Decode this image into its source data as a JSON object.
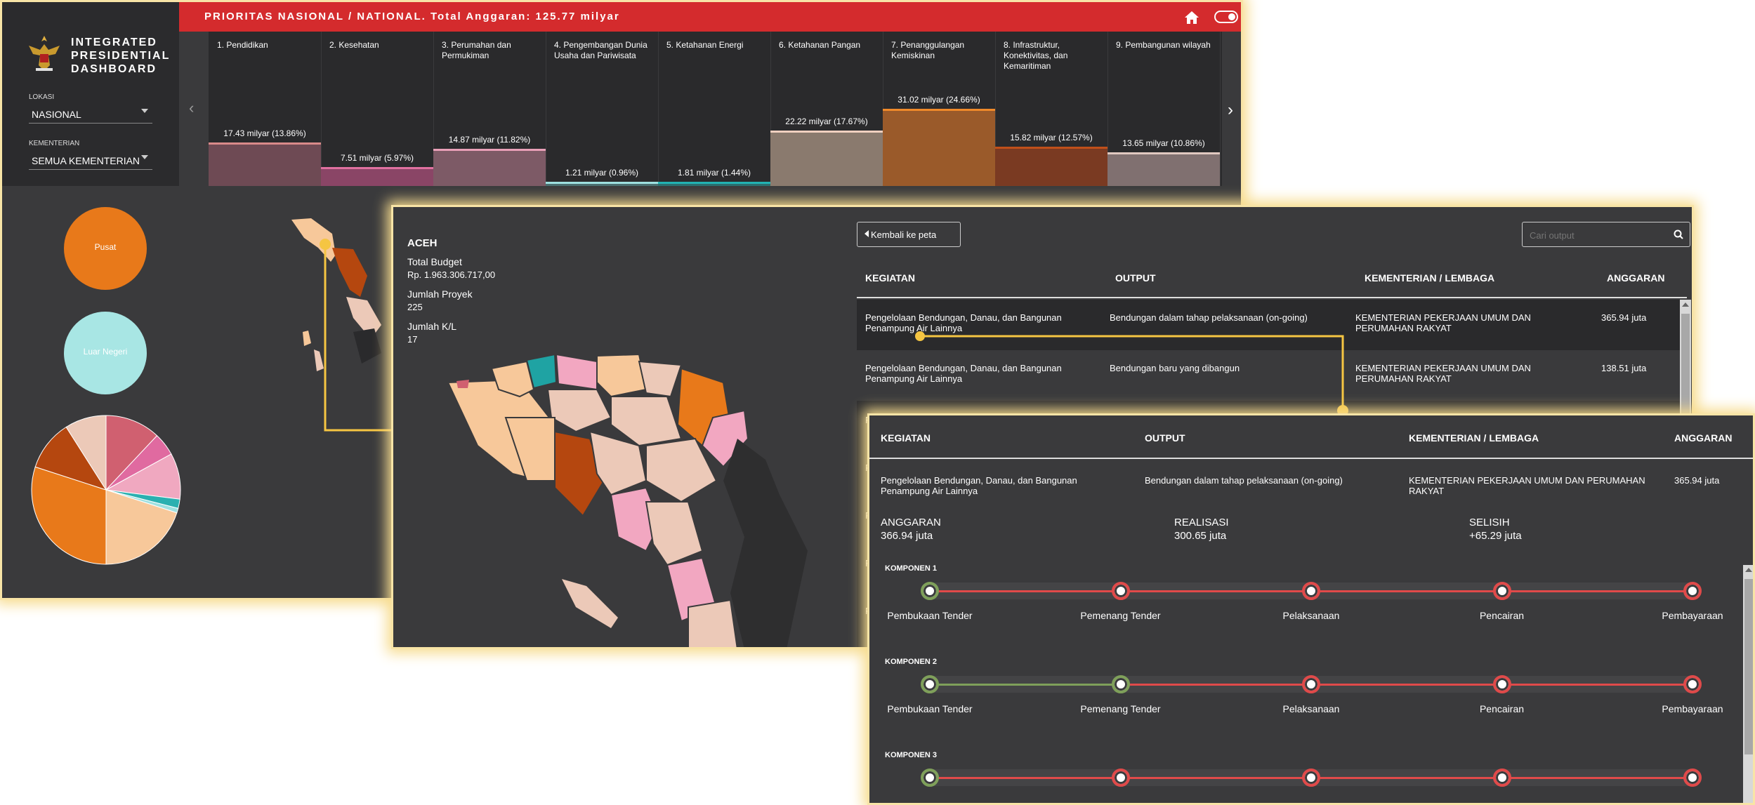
{
  "app": {
    "title_lines": [
      "INTEGRATED",
      "PRESIDENTIAL",
      "DASHBOARD"
    ]
  },
  "filters": {
    "lokasi_label": "LOKASI",
    "lokasi_value": "NASIONAL",
    "kementerian_label": "KEMENTERIAN",
    "kementerian_value": "SEMUA KEMENTERIAN"
  },
  "header": {
    "title": "PRIORITAS NASIONAL / NATIONAL. Total Anggaran: 125.77 milyar"
  },
  "categories": [
    {
      "label": "1. Pendidikan",
      "value_text": "17.43 milyar (13.86%)",
      "share": 13.86,
      "fill": "#6e4a54",
      "cap": "#d98a8a"
    },
    {
      "label": "2. Kesehatan",
      "value_text": "7.51 milyar (5.97%)",
      "share": 5.97,
      "fill": "#8a4566",
      "cap": "#e070a0"
    },
    {
      "label": "3. Perumahan dan Permukiman",
      "value_text": "14.87 milyar (11.82%)",
      "share": 11.82,
      "fill": "#7d5a66",
      "cap": "#e9a0b8"
    },
    {
      "label": "4. Pengembangan Dunia Usaha dan Pariwisata",
      "value_text": "1.21 milyar (0.96%)",
      "share": 0.96,
      "fill": "#4a6e70",
      "cap": "#9ee0e0"
    },
    {
      "label": "5. Ketahanan Energi",
      "value_text": "1.81 milyar (1.44%)",
      "share": 1.44,
      "fill": "#2a6f70",
      "cap": "#22b3b3"
    },
    {
      "label": "6. Ketahanan Pangan",
      "value_text": "22.22 milyar (17.67%)",
      "share": 17.67,
      "fill": "#8a7a6e",
      "cap": "#f0d0c0"
    },
    {
      "label": "7. Penanggulangan Kemiskinan",
      "value_text": "31.02 milyar (24.66%)",
      "share": 24.66,
      "fill": "#9a5a2a",
      "cap": "#f08a2a"
    },
    {
      "label": "8. Infrastruktur, Konektivitas, dan Kemaritiman",
      "value_text": "15.82 milyar (12.57%)",
      "share": 12.57,
      "fill": "#7a3a22",
      "cap": "#c0501a"
    },
    {
      "label": "9. Pembangunan wilayah",
      "value_text": "13.65 milyar (10.86%)",
      "share": 10.86,
      "fill": "#807070",
      "cap": "#e0c8c0"
    }
  ],
  "circles": {
    "pusat": "Pusat",
    "luar_negeri": "Luar Negeri"
  },
  "pie": {
    "slices": [
      {
        "share": 12,
        "color": "#d06070"
      },
      {
        "share": 5,
        "color": "#e06aa0"
      },
      {
        "share": 10,
        "color": "#f0a8c0"
      },
      {
        "share": 2,
        "color": "#2ab0b0"
      },
      {
        "share": 1,
        "color": "#9ee0e0"
      },
      {
        "share": 20,
        "color": "#f7c89a"
      },
      {
        "share": 30,
        "color": "#e8791a"
      },
      {
        "share": 11,
        "color": "#b5470f"
      },
      {
        "share": 9,
        "color": "#ecc9b8"
      }
    ]
  },
  "region": {
    "name": "ACEH",
    "budget_label": "Total Budget",
    "budget_value": "Rp. 1.963.306.717,00",
    "projects_label": "Jumlah Proyek",
    "projects_value": "225",
    "kl_label": "Jumlah K/L",
    "kl_value": "17"
  },
  "table": {
    "back_button": "Kembali ke peta",
    "search_placeholder": "Cari output",
    "headers": [
      "KEGIATAN",
      "OUTPUT",
      "KEMENTERIAN / LEMBAGA",
      "ANGGARAN"
    ],
    "rows": [
      {
        "kegiatan": "Pengelolaan Bendungan, Danau, dan Bangunan Penampung Air Lainnya",
        "output": "Bendungan dalam tahap pelaksanaan (on-going)",
        "kementerian": "KEMENTERIAN PEKERJAAN UMUM DAN PERUMAHAN RAKYAT",
        "anggaran": "365.94 juta"
      },
      {
        "kegiatan": "Pengelolaan Bendungan, Danau, dan Bangunan Penampung Air Lainnya",
        "output": "Bendungan baru yang dibangun",
        "kementerian": "KEMENTERIAN PEKERJAAN UMUM DAN PERUMAHAN RAKYAT",
        "anggaran": "138.51 juta"
      }
    ],
    "partial_rows": [
      "P",
      "P",
      "P",
      "P",
      "P"
    ]
  },
  "detail": {
    "headers": [
      "KEGIATAN",
      "OUTPUT",
      "KEMENTERIAN / LEMBAGA",
      "ANGGARAN"
    ],
    "row": {
      "kegiatan": "Pengelolaan Bendungan, Danau, dan Bangunan Penampung Air Lainnya",
      "output": "Bendungan dalam tahap pelaksanaan (on-going)",
      "kementerian": "KEMENTERIAN PEKERJAAN UMUM DAN PERUMAHAN RAKYAT",
      "anggaran": "365.94 juta"
    },
    "anggaran_label": "ANGGARAN",
    "anggaran_value": "366.94 juta",
    "realisasi_label": "REALISASI",
    "realisasi_value": "300.65 juta",
    "selisih_label": "SELISIH",
    "selisih_value": "+65.29 juta",
    "steps": [
      "Pembukaan Tender",
      "Pemenang Tender",
      "Pelaksanaan",
      "Pencairan",
      "Pembayaraan"
    ],
    "components": [
      {
        "label": "KOMPONEN 1",
        "done": 1
      },
      {
        "label": "KOMPONEN 2",
        "done": 2
      },
      {
        "label": "KOMPONEN 3",
        "done": 1
      }
    ]
  },
  "colors": {
    "accent_red": "#d42b2d",
    "dark_bg": "#3a3a3c",
    "highlight": "#f5c542",
    "done_green": "#7fa05a",
    "todo_red": "#e04a4a"
  },
  "icons": {
    "home": "home-icon",
    "toggle": "toggle-icon",
    "search": "search-icon",
    "prev": "chevron-left-icon",
    "next": "chevron-right-icon",
    "logo": "garuda-emblem"
  }
}
